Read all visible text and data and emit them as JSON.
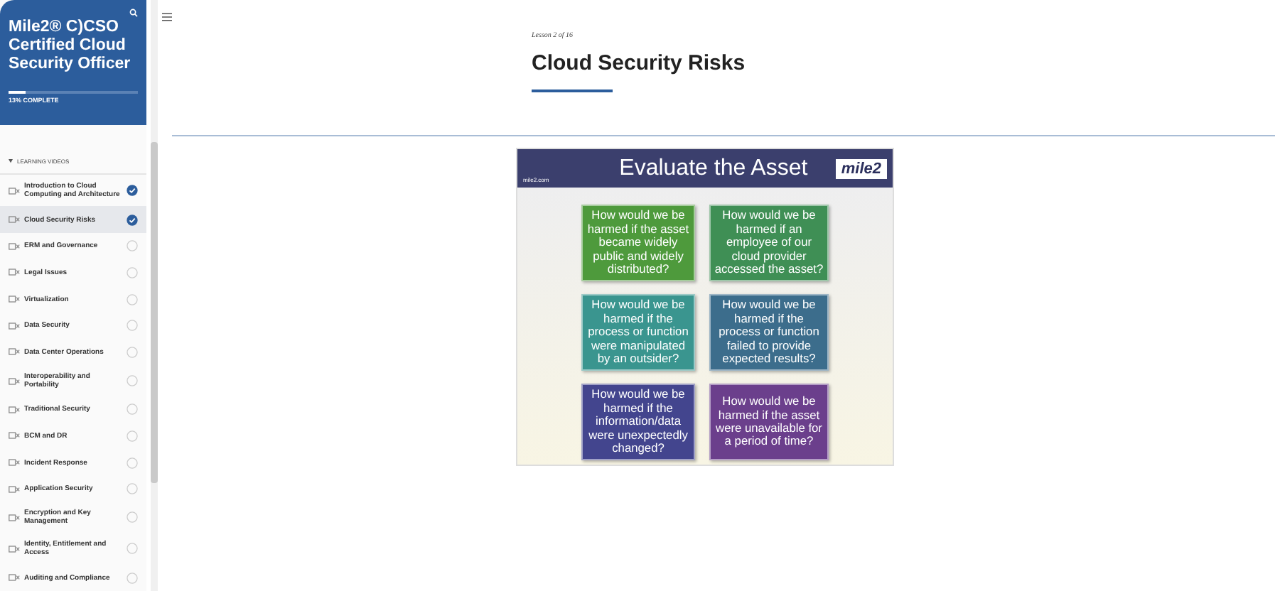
{
  "sidebar": {
    "course_title": "Mile2® C)CSO Certified Cloud Security Officer",
    "progress": {
      "level": 0.13,
      "label": "13% COMPLETE"
    },
    "section": "LEARNING VIDEOS",
    "items": [
      {
        "label": "Introduction to Cloud Computing and Architecture",
        "completed": true,
        "selected": false
      },
      {
        "label": "Cloud Security Risks",
        "completed": true,
        "selected": true
      },
      {
        "label": "ERM and Governance",
        "completed": false,
        "selected": false
      },
      {
        "label": "Legal Issues",
        "completed": false,
        "selected": false
      },
      {
        "label": "Virtualization",
        "completed": false,
        "selected": false
      },
      {
        "label": "Data Security",
        "completed": false,
        "selected": false
      },
      {
        "label": "Data Center Operations",
        "completed": false,
        "selected": false
      },
      {
        "label": "Interoperability and Portability",
        "completed": false,
        "selected": false
      },
      {
        "label": "Traditional Security",
        "completed": false,
        "selected": false
      },
      {
        "label": "BCM and DR",
        "completed": false,
        "selected": false
      },
      {
        "label": "Incident Response",
        "completed": false,
        "selected": false
      },
      {
        "label": "Application Security",
        "completed": false,
        "selected": false
      },
      {
        "label": "Encryption and Key Management",
        "completed": false,
        "selected": false
      },
      {
        "label": "Identity, Entitlement and Access",
        "completed": false,
        "selected": false
      },
      {
        "label": "Auditing and Compliance",
        "completed": false,
        "selected": false
      }
    ]
  },
  "lesson": {
    "counter": "Lesson 2 of 16",
    "title": "Cloud Security Risks"
  },
  "slide": {
    "site": "mile2.com",
    "title": "Evaluate the Asset",
    "logo": "mile2",
    "boxes": [
      {
        "text": "How would we be harmed if the asset became widely public and widely distributed?",
        "color": "#4e9a3c"
      },
      {
        "text": "How would we be harmed if an employee of our cloud provider accessed the asset?",
        "color": "#3f8f55"
      },
      {
        "text": "How would we be harmed if the process or function were manipulated by an outsider?",
        "color": "#3a958f"
      },
      {
        "text": "How would we be harmed if the process or function failed to provide expected results?",
        "color": "#3c6d8c"
      },
      {
        "text": "How would we be harmed if the information/data were unexpectedly changed?",
        "color": "#43458e"
      },
      {
        "text": "How would we be harmed if the asset were unavailable for a period of time?",
        "color": "#6b3f8c"
      }
    ]
  }
}
